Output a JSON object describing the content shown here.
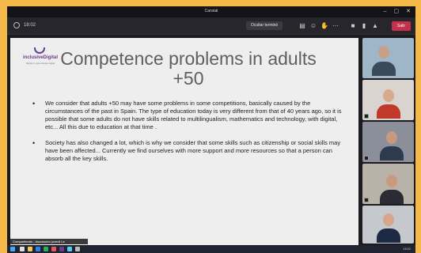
{
  "window": {
    "title": "Cansial"
  },
  "toolbar": {
    "time": "18:02",
    "people_label": "Ocultar terminó",
    "leave_label": "Salir"
  },
  "slide": {
    "logo": {
      "name": "inclusiveDigital",
      "tagline": "Digital in aprendizaje digital"
    },
    "title": "Competence problems in adults +50",
    "bullets": [
      "We consider that adults +50 may have some problems in some competitions, basically caused by the circumstances of the past in Spain. The type of education today is very different from that of 40 years ago, so it is possible that some adults do not have skills related to multilingualism, mathematics and technology, with digital, etc... All this due to education at that time .",
      "Society has also changed a lot, which is why we consider that some skills such as citizenship or social skills may have been affected... Currently we find ourselves with more support and more resources so that a person can absorb all the key skills."
    ],
    "presenter_tag": "Compartiendo - Asociación juvenil Le"
  },
  "participants": [
    {
      "name": "participant-1",
      "bg": "#9fb6c9",
      "skin": "#c9a086",
      "shirt": "#3b4a5a"
    },
    {
      "name": "participant-2",
      "bg": "#d9d4cf",
      "skin": "#d8a98a",
      "shirt": "#c0392b"
    },
    {
      "name": "participant-3",
      "bg": "#8a8f99",
      "skin": "#c79a80",
      "shirt": "#2e3b4e"
    },
    {
      "name": "participant-4",
      "bg": "#b9b2a8",
      "skin": "#c99a7d",
      "shirt": "#2b2b33"
    },
    {
      "name": "participant-5",
      "bg": "#c5c8cc",
      "skin": "#d6a58a",
      "shirt": "#1c2a44"
    }
  ],
  "taskbar": {
    "tray_text": "13:02"
  },
  "colors": {
    "accent": "#6a3d8a",
    "leave": "#c4314b",
    "frame": "#f5b94a"
  }
}
